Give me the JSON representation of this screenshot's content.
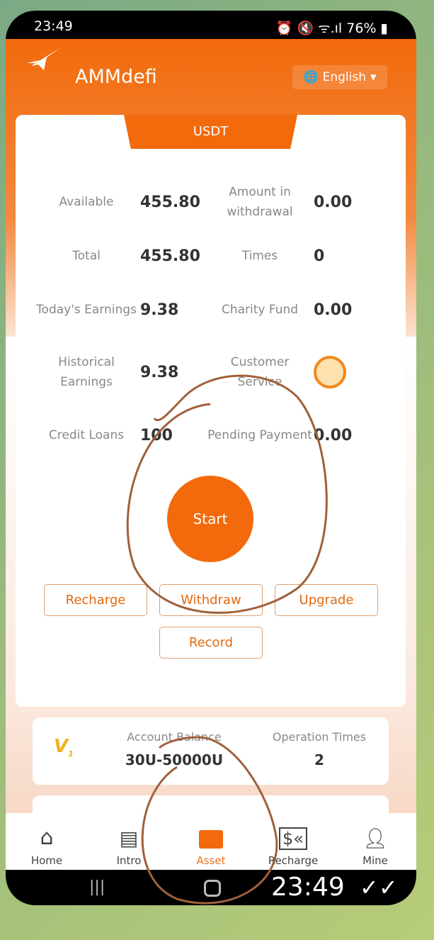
{
  "status_bar": {
    "time": "23:49",
    "battery": "76%"
  },
  "header": {
    "brand": "AMMdefi",
    "language": "English"
  },
  "card": {
    "tab": "USDT",
    "stats": [
      {
        "label": "Available",
        "value": "455.80"
      },
      {
        "label": "Amount in withdrawal",
        "value": "0.00"
      },
      {
        "label": "Total",
        "value": "455.80"
      },
      {
        "label": "Times",
        "value": "0"
      },
      {
        "label": "Today's Earnings",
        "value": "9.38"
      },
      {
        "label": "Charity Fund",
        "value": "0.00"
      },
      {
        "label": "Historical Earnings",
        "value": "9.38"
      },
      {
        "label": "Customer Service",
        "value": ""
      },
      {
        "label": "Credit Loans",
        "value": "100"
      },
      {
        "label": "Pending Payment",
        "value": "0.00"
      }
    ],
    "start": "Start",
    "buttons": {
      "recharge": "Recharge",
      "withdraw": "Withdraw",
      "upgrade": "Upgrade",
      "record": "Record"
    }
  },
  "level": {
    "badge": "V1",
    "balance_label": "Account Balance",
    "balance_value": "30U-50000U",
    "times_label": "Operation Times",
    "times_value": "2"
  },
  "nav": [
    {
      "label": "Home"
    },
    {
      "label": "Intro"
    },
    {
      "label": "Asset"
    },
    {
      "label": "Recharge"
    },
    {
      "label": "Mine"
    }
  ],
  "message": {
    "time": "23:49"
  },
  "colors": {
    "accent": "#f26a0c",
    "ink": "#a0603a"
  }
}
